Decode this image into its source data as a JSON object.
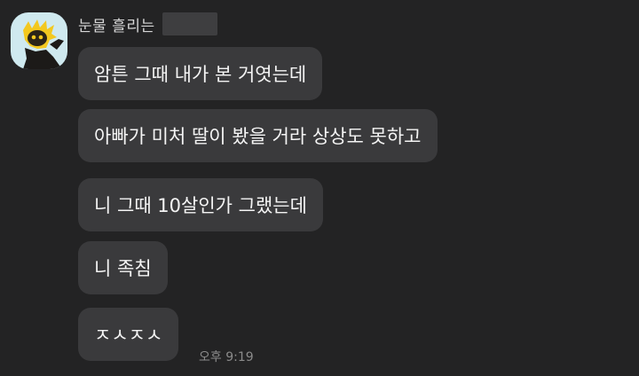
{
  "chat": {
    "sender_name": "눈물 흘리는",
    "messages": [
      {
        "text": "암튼 그때 내가 본 거엿는데"
      },
      {
        "text": "아빠가 미처 딸이 봤을 거라 상상도 못하고"
      },
      {
        "text": "니 그때 10살인가 그랬는데"
      },
      {
        "text": "니 족침"
      },
      {
        "text": "ㅈㅅㅈㅅ"
      }
    ],
    "last_time": "오후 9:19"
  },
  "colors": {
    "background": "#232324",
    "bubble": "#3a3a3c",
    "avatar_bg": "#cfe9ef"
  },
  "icons": {
    "avatar": "yellow-character-avatar"
  }
}
